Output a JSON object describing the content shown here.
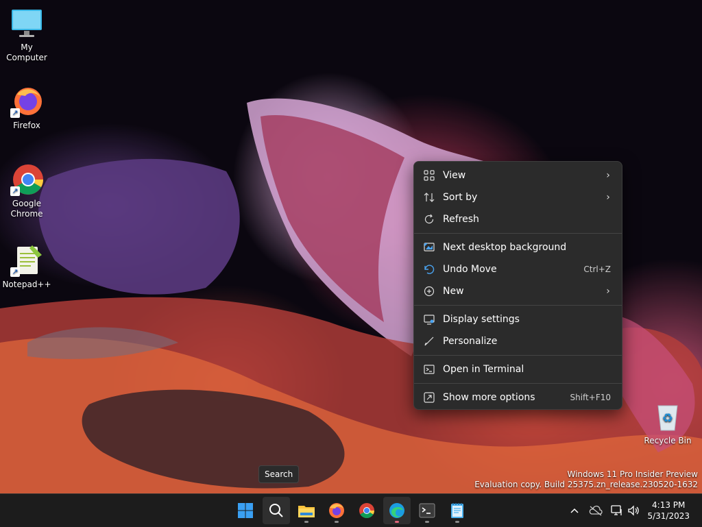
{
  "desktop": {
    "icons": [
      {
        "label": "My Computer",
        "icon": "monitor-icon"
      },
      {
        "label": "Firefox",
        "icon": "firefox-icon"
      },
      {
        "label": "Google Chrome",
        "icon": "chrome-icon"
      },
      {
        "label": "Notepad++",
        "icon": "notepadpp-icon"
      },
      {
        "label": "Recycle Bin",
        "icon": "recycle-bin-icon"
      }
    ]
  },
  "context_menu": {
    "items": [
      {
        "label": "View",
        "icon": "view-grid-icon",
        "submenu": true
      },
      {
        "label": "Sort by",
        "icon": "sort-icon",
        "submenu": true
      },
      {
        "label": "Refresh",
        "icon": "refresh-icon"
      },
      {
        "label": "Next desktop background",
        "icon": "next-background-icon"
      },
      {
        "label": "Undo Move",
        "icon": "undo-icon",
        "shortcut": "Ctrl+Z"
      },
      {
        "label": "New",
        "icon": "new-plus-icon",
        "submenu": true
      },
      {
        "label": "Display settings",
        "icon": "display-settings-icon"
      },
      {
        "label": "Personalize",
        "icon": "personalize-brush-icon"
      },
      {
        "label": "Open in Terminal",
        "icon": "terminal-icon"
      },
      {
        "label": "Show more options",
        "icon": "more-options-icon",
        "shortcut": "Shift+F10"
      }
    ],
    "chevron": "›"
  },
  "watermark": {
    "line1": "Windows 11 Pro Insider Preview",
    "line2": "Evaluation copy. Build 25375.zn_release.230520-1632"
  },
  "tooltip": {
    "text": "Search"
  },
  "taskbar": {
    "apps": [
      "start-icon",
      "search-icon",
      "file-explorer-icon",
      "firefox-icon",
      "chrome-icon",
      "edge-icon",
      "terminal-icon",
      "notepad-icon"
    ],
    "tray": [
      "chevron-up-icon",
      "onedrive-icon",
      "network-icon",
      "volume-icon"
    ],
    "clock": {
      "time": "4:13 PM",
      "date": "5/31/2023"
    }
  },
  "colors": {
    "menu_bg": "#2b2b2b",
    "taskbar_bg": "#1c1c1c",
    "accent": "#0078d4"
  }
}
